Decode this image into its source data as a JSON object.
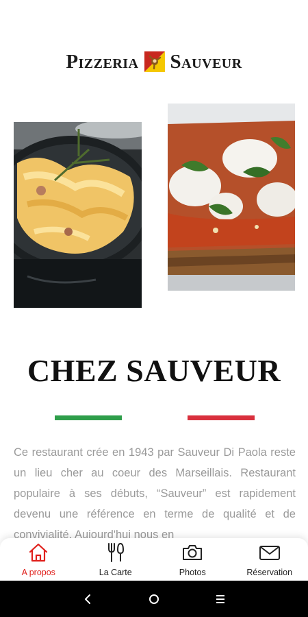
{
  "brand": {
    "word_left": "Pizzeria",
    "word_right": "Sauveur",
    "flag_icon": "sicily-flag-icon",
    "colors": {
      "flag_red": "#c8281e",
      "flag_yellow": "#f5c800"
    }
  },
  "photos": [
    {
      "name": "pasta-photo",
      "alt": "pasta-dish-image"
    },
    {
      "name": "pizza-photo",
      "alt": "pizza-image"
    }
  ],
  "headline": "CHEZ SAUVEUR",
  "divider_colors": {
    "green": "#2e9e4a",
    "red": "#d9303d"
  },
  "about_text": "Ce restaurant crée en 1943 par Sauveur Di Paola reste un lieu cher au coeur des Marseillais. Restaurant populaire à ses débuts, “Sauveur” est rapidement devenu une référence en terme de qualité et de convivialité. Aujourd'hui nous en",
  "tabs": [
    {
      "label": "A propos",
      "icon": "home-icon",
      "active": true
    },
    {
      "label": "La Carte",
      "icon": "cutlery-icon",
      "active": false
    },
    {
      "label": "Photos",
      "icon": "camera-icon",
      "active": false
    },
    {
      "label": "Réservation",
      "icon": "envelope-icon",
      "active": false
    }
  ],
  "accent_color": "#e0201c",
  "system_nav": {
    "back_icon": "back-chevron-icon",
    "home_icon": "home-circle-icon",
    "recents_icon": "recents-icon"
  }
}
